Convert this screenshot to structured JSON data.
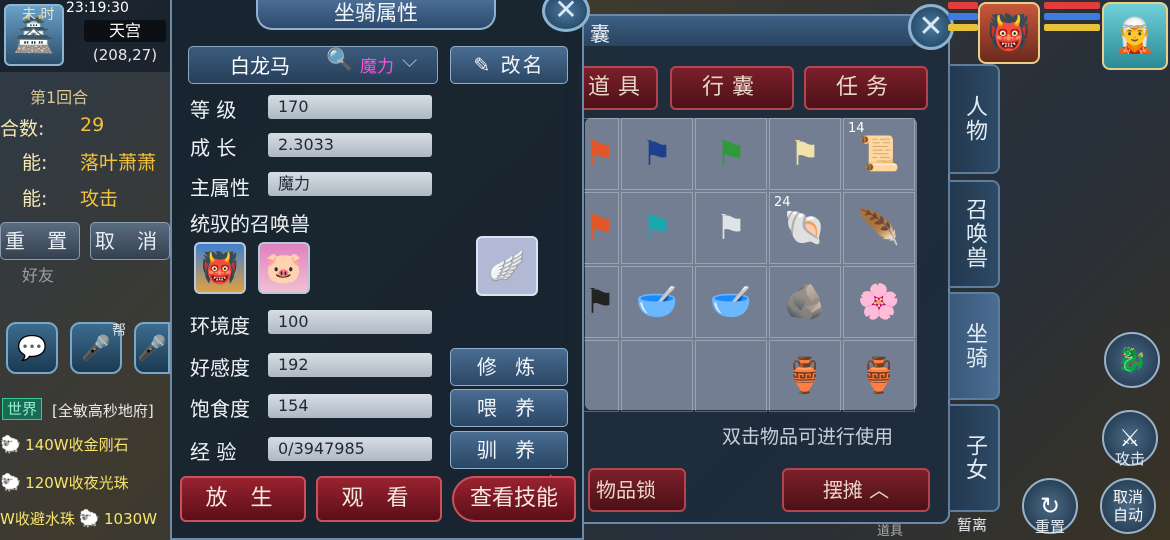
{
  "topleft": {
    "time_symbol": "未 时",
    "clock": "23:19:30",
    "location": "天宫",
    "coords": "(208,27)"
  },
  "battle": {
    "round": "第1回合",
    "rows": [
      {
        "label": "合数:",
        "value": "29"
      },
      {
        "label": "能:",
        "value": "落叶萧萧"
      },
      {
        "label": "能:",
        "value": "攻击"
      }
    ],
    "reset": "重 置",
    "cancel": "取 消"
  },
  "social": {
    "friend": "好友",
    "help": "帮"
  },
  "chat": {
    "world_tag": "世界",
    "world_msg": "[全敏高秒地府]",
    "lines": [
      "140W收金刚石",
      "120W收夜光珠",
      "W收避水珠",
      "1030W"
    ]
  },
  "mount": {
    "title": "坐骑属性",
    "name": "白龙马",
    "attr_tag": "魔力",
    "rename": "改名",
    "rows": [
      {
        "label": "等  级",
        "value": "170"
      },
      {
        "label": "成  长",
        "value": "2.3033"
      },
      {
        "label": "主属性",
        "value": "魔力"
      }
    ],
    "pets_label": "统驭的召唤兽",
    "rows2": [
      {
        "label": "环境度",
        "value": "100"
      },
      {
        "label": "好感度",
        "value": "192"
      },
      {
        "label": "饱食度",
        "value": "154"
      },
      {
        "label": "经  验",
        "value": "0/3947985"
      }
    ],
    "btn_train": "修 炼",
    "btn_feed": "喂 养",
    "btn_tame": "驯 养",
    "btn_release": "放 生",
    "btn_view": "观 看",
    "btn_skill": "查看技能"
  },
  "bag": {
    "title": "囊",
    "tabs": [
      "道具",
      "行囊",
      "任务"
    ],
    "counts": {
      "c14": "14",
      "c24": "24"
    },
    "hint": "双击物品可进行使用",
    "lock": "物品锁",
    "stall": "摆摊",
    "side_tabs": [
      "人物",
      "召唤兽",
      "坐骑",
      "子女"
    ],
    "colors": {
      "flag_blue": "#1e3f8f",
      "flag_green": "#2f9a3a"
    }
  },
  "hud": {
    "attack": "攻击",
    "reset": "重置",
    "cancel_auto": "取消\n自动",
    "pause": "暂离",
    "pause2": "道具"
  }
}
